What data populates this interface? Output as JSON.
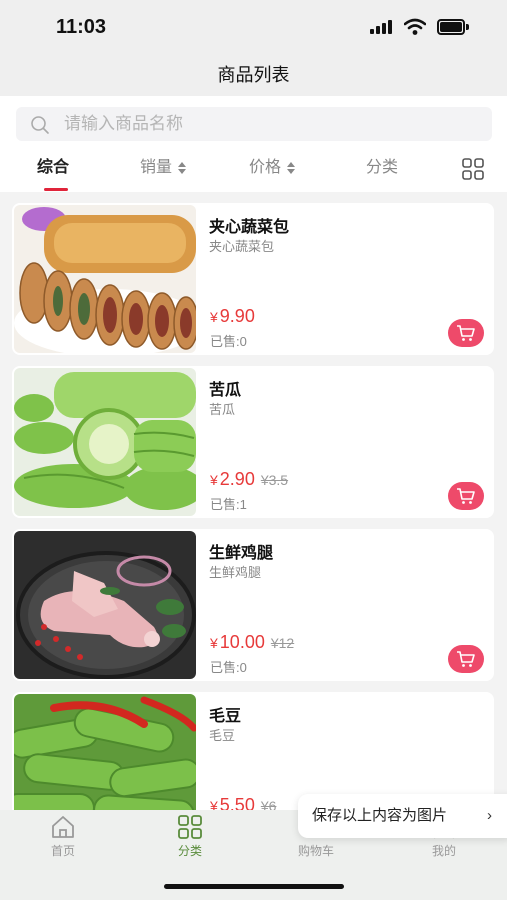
{
  "status_bar": {
    "time": "11:03"
  },
  "nav": {
    "title": "商品列表"
  },
  "search": {
    "placeholder": "请输入商品名称"
  },
  "filters": {
    "tabs": [
      {
        "label": "综合",
        "active": true
      },
      {
        "label": "销量"
      },
      {
        "label": "价格"
      },
      {
        "label": "分类"
      }
    ],
    "view_toggle_icon": "grid-icon"
  },
  "products": [
    {
      "name": "夹心蔬菜包",
      "subtitle": "夹心蔬菜包",
      "currency": "¥",
      "price": "9.90",
      "old_price": "",
      "sold": "已售:0"
    },
    {
      "name": "苦瓜",
      "subtitle": "苦瓜",
      "currency": "¥",
      "price": "2.90",
      "old_price": "¥3.5",
      "sold": "已售:1"
    },
    {
      "name": "生鲜鸡腿",
      "subtitle": "生鲜鸡腿",
      "currency": "¥",
      "price": "10.00",
      "old_price": "¥12",
      "sold": "已售:0"
    },
    {
      "name": "毛豆",
      "subtitle": "毛豆",
      "currency": "¥",
      "price": "5.50",
      "old_price": "¥6",
      "sold": ""
    }
  ],
  "save_popup": {
    "label": "保存以上内容为图片",
    "chevron": "›"
  },
  "tab_bar": {
    "items": [
      {
        "label": "首页",
        "icon": "home-icon"
      },
      {
        "label": "分类",
        "icon": "category-icon",
        "active": true
      },
      {
        "label": "购物车",
        "icon": "cart-icon"
      },
      {
        "label": "我的",
        "icon": "user-icon"
      }
    ]
  },
  "colors": {
    "accent": "#e0243a",
    "price": "#e73a3a",
    "cart_button": "#ee4a6a",
    "active_tab": "#5a8c3c"
  }
}
